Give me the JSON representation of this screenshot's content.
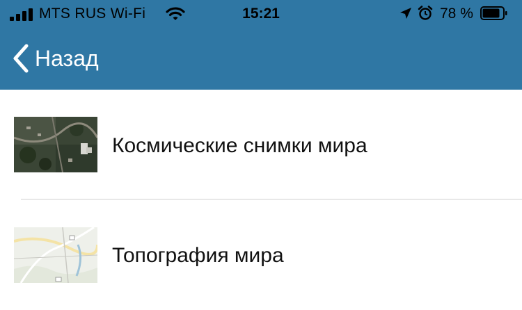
{
  "status_bar": {
    "carrier": "MTS RUS Wi-Fi",
    "time": "15:21",
    "battery_percent": "78 %",
    "icons": [
      "signal-icon",
      "wifi-icon",
      "location-arrow-icon",
      "alarm-icon",
      "battery-icon"
    ]
  },
  "header": {
    "back_label": "Назад",
    "background_color": "#2f77a4"
  },
  "basemaps": [
    {
      "label": "Космические снимки мира",
      "thumbnail": "satellite-imagery-thumbnail"
    },
    {
      "label": "Топография мира",
      "thumbnail": "topographic-map-thumbnail"
    }
  ]
}
